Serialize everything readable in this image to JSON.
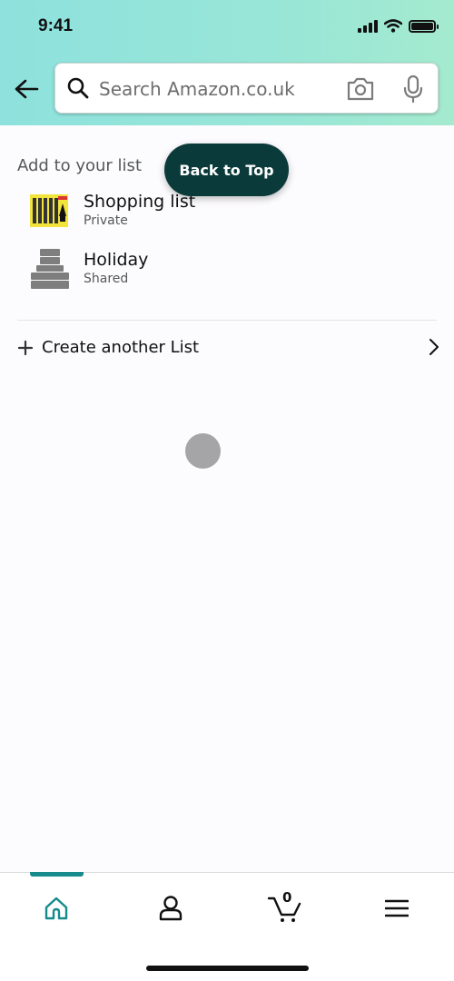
{
  "status_bar": {
    "time": "9:41"
  },
  "search": {
    "placeholder": "Search Amazon.co.uk",
    "value": ""
  },
  "main": {
    "section_title": "Add to your list",
    "back_to_top_label": "Back to Top",
    "lists": [
      {
        "name": "Shopping list",
        "visibility": "Private",
        "thumbnail": "air-freshener-pack"
      },
      {
        "name": "Holiday",
        "visibility": "Shared",
        "thumbnail": "towel-stack"
      }
    ],
    "create_list_label": "Create another List"
  },
  "tabbar": {
    "active_color": "#178a8c",
    "tabs": [
      {
        "name": "home",
        "icon": "home-icon",
        "active": true
      },
      {
        "name": "account",
        "icon": "person-icon",
        "active": false
      },
      {
        "name": "cart",
        "icon": "cart-icon",
        "active": false,
        "count": "0"
      },
      {
        "name": "menu",
        "icon": "hamburger-menu-icon",
        "active": false
      }
    ]
  }
}
